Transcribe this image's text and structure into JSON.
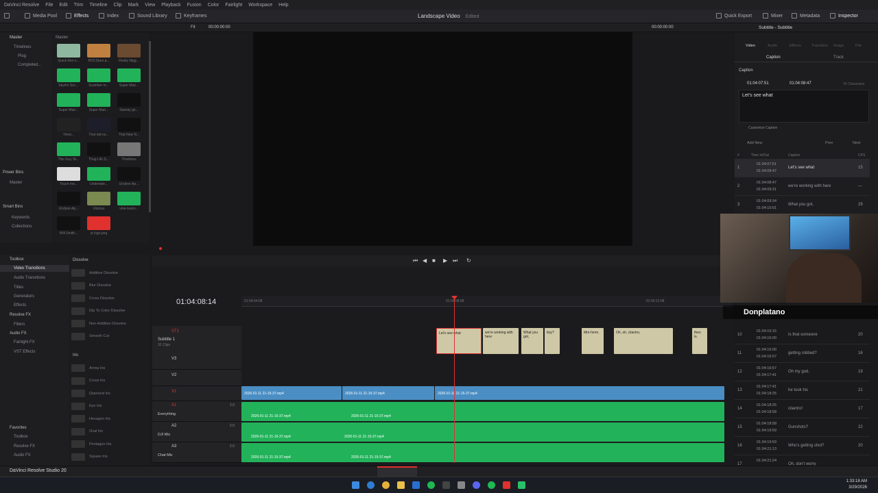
{
  "menu": [
    "DaVinci Resolve",
    "File",
    "Edit",
    "Trim",
    "Timeline",
    "Clip",
    "Mark",
    "View",
    "Playback",
    "Fusion",
    "Color",
    "Fairlight",
    "Workspace",
    "Help"
  ],
  "toolbar": {
    "media_pool": "Media Pool",
    "effects": "Effects",
    "index": "Index",
    "sound_library": "Sound Library",
    "keyframes": "Keyframes",
    "project": "Landscape Video",
    "edited": "Edited",
    "quick_export": "Quick Export",
    "mixer": "Mixer",
    "metadata": "Metadata",
    "inspector": "Inspector"
  },
  "subbar": {
    "fit": "Fit",
    "tc_left": "00:00:00:00",
    "tc_right": "00:00:00:00",
    "inspector_title": "Subtitle - Subtitle"
  },
  "bins": {
    "master": "Master",
    "master2": "Master",
    "timelines": "Timelines",
    "plug": "Plug",
    "completed": "Completed...",
    "power_bins": "Power Bins",
    "pb_master": "Master",
    "smart_bins": "Smart Bins",
    "keywords": "Keywords",
    "collections": "Collections"
  },
  "media": [
    [
      "Quick Ren s...",
      "ROCStars p...",
      "Really Nigg..."
    ],
    [
      "Skyrim Sec...",
      "Scamber m...",
      "Super Mari..."
    ],
    [
      "Super Mari...",
      "Super Mari...",
      "Sweety go..."
    ],
    [
      "Timer...",
      "That did no...",
      "That New N..."
    ],
    [
      "This Guy Sli...",
      "Thug Life S...",
      "Timelines"
    ],
    [
      "Touch me...",
      "Undertale...",
      "Undyne Ap..."
    ],
    [
      "Undyne Ap...",
      "Vinicius",
      "vine-boom..."
    ],
    [
      "Will Smith...",
      "yt logo.png",
      ""
    ]
  ],
  "toolbox": {
    "toolbox": "Toolbox",
    "video_transitions": "Video Transitions",
    "audio_transitions": "Audio Transitions",
    "titles": "Titles",
    "generators": "Generators",
    "effects": "Effects",
    "resolve_fx": "Resolve FX",
    "filters": "Filters",
    "audio_fx": "Audio FX",
    "fairlight_fx": "Fairlight FX",
    "vst_effects": "VST Effects",
    "favorites": "Favorites",
    "fav_toolbox": "Toolbox",
    "fav_resolvefx": "Resolve FX",
    "fav_audiofx": "Audio FX"
  },
  "dissolve": {
    "header": "Dissolve",
    "items": [
      "Additive Dissolve",
      "Blur Dissolve",
      "Cross Dissolve",
      "Dip To Color Dissolve",
      "Non-Additive Dissolve",
      "Smooth Cut"
    ]
  },
  "iris": {
    "header": "Iris",
    "items": [
      "Arrow Iris",
      "Cross Iris",
      "Diamond Iris",
      "Eye Iris",
      "Hexagon Iris",
      "Oval Iris",
      "Pentagon Iris",
      "Square Iris"
    ]
  },
  "timeline": {
    "timecode": "01:04:08:14",
    "ruler": [
      "01:04:04:08",
      "01:04:08:08",
      "01:04:12:08"
    ],
    "st1": "ST1",
    "subtitle_name": "Subtitle 1",
    "clips_count": "32 Clips",
    "v3": "V3",
    "v2": "V2",
    "v1": "V1",
    "a1": "A1",
    "a1_name": "Everything",
    "a2": "A2",
    "a2_name": "DJI Mic",
    "a3": "A3",
    "a3_name": "Chat Mic",
    "vol": "2.0",
    "dim": "DIM"
  },
  "subtitles": [
    "Let's see what",
    "we're working with here",
    "What you got,",
    "boy?",
    "Mm-hmm.",
    "Oh, oh, cilantro,",
    "then is."
  ],
  "clipname": "2026-01-11 21-15-37.mp4",
  "inspector": {
    "tabs": [
      "Video",
      "Audio",
      "Effects",
      "Transition",
      "Image",
      "File"
    ],
    "caption": "Caption",
    "track": "Track",
    "caption_label": "Caption",
    "in": "01:04:07:51",
    "out": "01:04:08:47",
    "chars": "14 Characters",
    "text": "Let's see what",
    "customize": "Customize Caption",
    "add_new": "Add New",
    "prev": "Prev",
    "next": "Next",
    "col_hash": "#",
    "col_time": "Time In/Out",
    "col_caption": "Caption",
    "col_cps": "CPS"
  },
  "captions": [
    {
      "n": "1",
      "in": "01:04:07:51",
      "out": "01:04:08:47",
      "text": "Let's see what",
      "cps": "15"
    },
    {
      "n": "2",
      "in": "01:04:08:47",
      "out": "01:04:09:31",
      "text": "we're working with here",
      "cps": "—"
    },
    {
      "n": "3",
      "in": "01:04:09:34",
      "out": "01:04:10:01",
      "text": "What you got,",
      "cps": "29"
    },
    {
      "n": "10",
      "in": "01:04:15:15",
      "out": "01:04:16:00",
      "text": "Is that someone",
      "cps": "20"
    },
    {
      "n": "11",
      "in": "01:04:16:00",
      "out": "01:04:16:57",
      "text": "getting robbed?",
      "cps": "16"
    },
    {
      "n": "12",
      "in": "01:04:16:57",
      "out": "01:04:17:41",
      "text": "Oh my god,",
      "cps": "19"
    },
    {
      "n": "13",
      "in": "01:04:17:41",
      "out": "01:04:18:25",
      "text": "he took his",
      "cps": "21"
    },
    {
      "n": "14",
      "in": "01:04:18:25",
      "out": "01:04:18:58",
      "text": "cilantro!",
      "cps": "17"
    },
    {
      "n": "15",
      "in": "01:04:18:58",
      "out": "01:04:19:59",
      "text": "Gunshots?",
      "cps": "22"
    },
    {
      "n": "16",
      "in": "01:04:19:59",
      "out": "01:04:21:13",
      "text": "Who's getting shot?",
      "cps": "20"
    },
    {
      "n": "17",
      "in": "01:04:21:24",
      "out": "",
      "text": "Oh, don't worry",
      "cps": ""
    }
  ],
  "overlay": {
    "name": "Donplatano"
  },
  "app": {
    "name": "DaVinci Resolve Studio 20"
  },
  "clock": {
    "time": "1:33:18 AM",
    "date": "3/29/2026"
  },
  "colors": {
    "accent": "#e0312f",
    "video_clip": "#4a8ec4",
    "audio_clip": "#22b35a",
    "subtitle_clip": "#cfc8a6"
  }
}
